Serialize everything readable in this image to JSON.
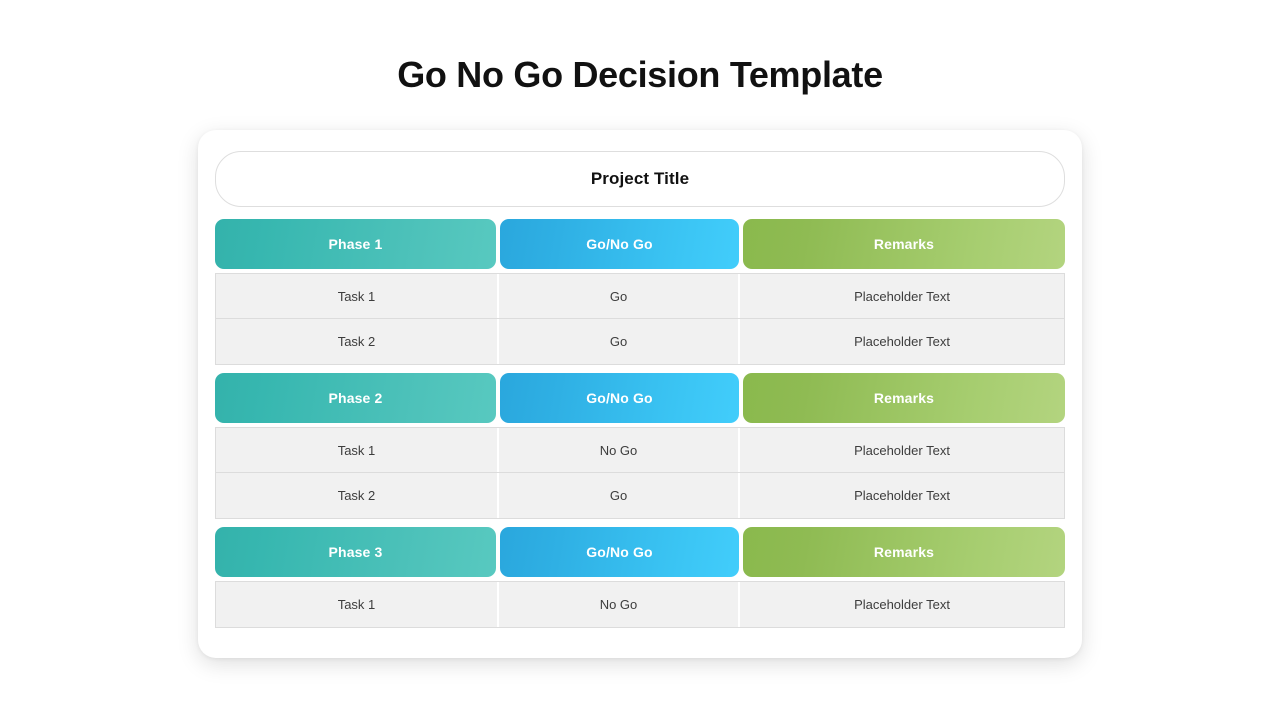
{
  "page": {
    "title": "Go No Go Decision Template",
    "background_color": "#ffffff"
  },
  "card": {
    "project_title": "Project Title",
    "accent_colors": {
      "phase_teal_start": "#34b2ab",
      "phase_teal_end": "#58c9c0",
      "verdict_blue_start": "#2aa7dd",
      "verdict_blue_end": "#42cdfb",
      "remarks_green_start": "#8ab94d",
      "remarks_green_end": "#b3d47f",
      "row_background": "#f1f1f1",
      "row_border": "#dcdcdc",
      "row_text": "#3d3d3d"
    },
    "sections": [
      {
        "headers": {
          "phase": "Phase 1",
          "verdict": "Go/No Go",
          "remarks": "Remarks"
        },
        "rows": [
          {
            "task": "Task 1",
            "verdict": "Go",
            "remarks": "Placeholder  Text"
          },
          {
            "task": "Task 2",
            "verdict": "Go",
            "remarks": "Placeholder  Text"
          }
        ]
      },
      {
        "headers": {
          "phase": "Phase 2",
          "verdict": "Go/No Go",
          "remarks": "Remarks"
        },
        "rows": [
          {
            "task": "Task 1",
            "verdict": "No Go",
            "remarks": "Placeholder  Text"
          },
          {
            "task": "Task 2",
            "verdict": "Go",
            "remarks": "Placeholder  Text"
          }
        ]
      },
      {
        "headers": {
          "phase": "Phase 3",
          "verdict": "Go/No Go",
          "remarks": "Remarks"
        },
        "rows": [
          {
            "task": "Task 1",
            "verdict": "No Go",
            "remarks": "Placeholder  Text"
          }
        ]
      }
    ]
  }
}
